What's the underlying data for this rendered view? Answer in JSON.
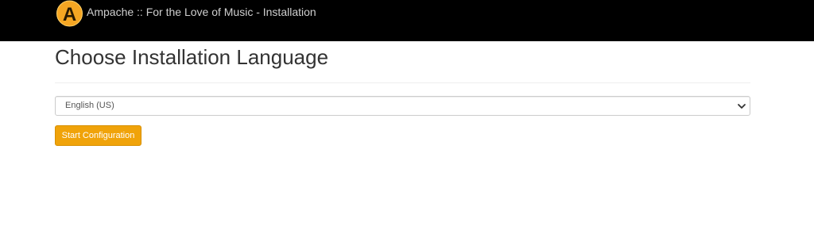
{
  "header": {
    "app_title": "Ampache :: For the Love of Music - Installation",
    "logo_letter": "A",
    "logo_icon": "ampache-logo-icon",
    "background_color": "#000000",
    "logo_color": "#f5a623"
  },
  "main": {
    "heading": "Choose Installation Language",
    "language_select": {
      "selected": "English (US)",
      "icon": "chevron-down-icon"
    },
    "start_button": {
      "label": "Start Configuration",
      "color": "#f0a30a"
    }
  }
}
